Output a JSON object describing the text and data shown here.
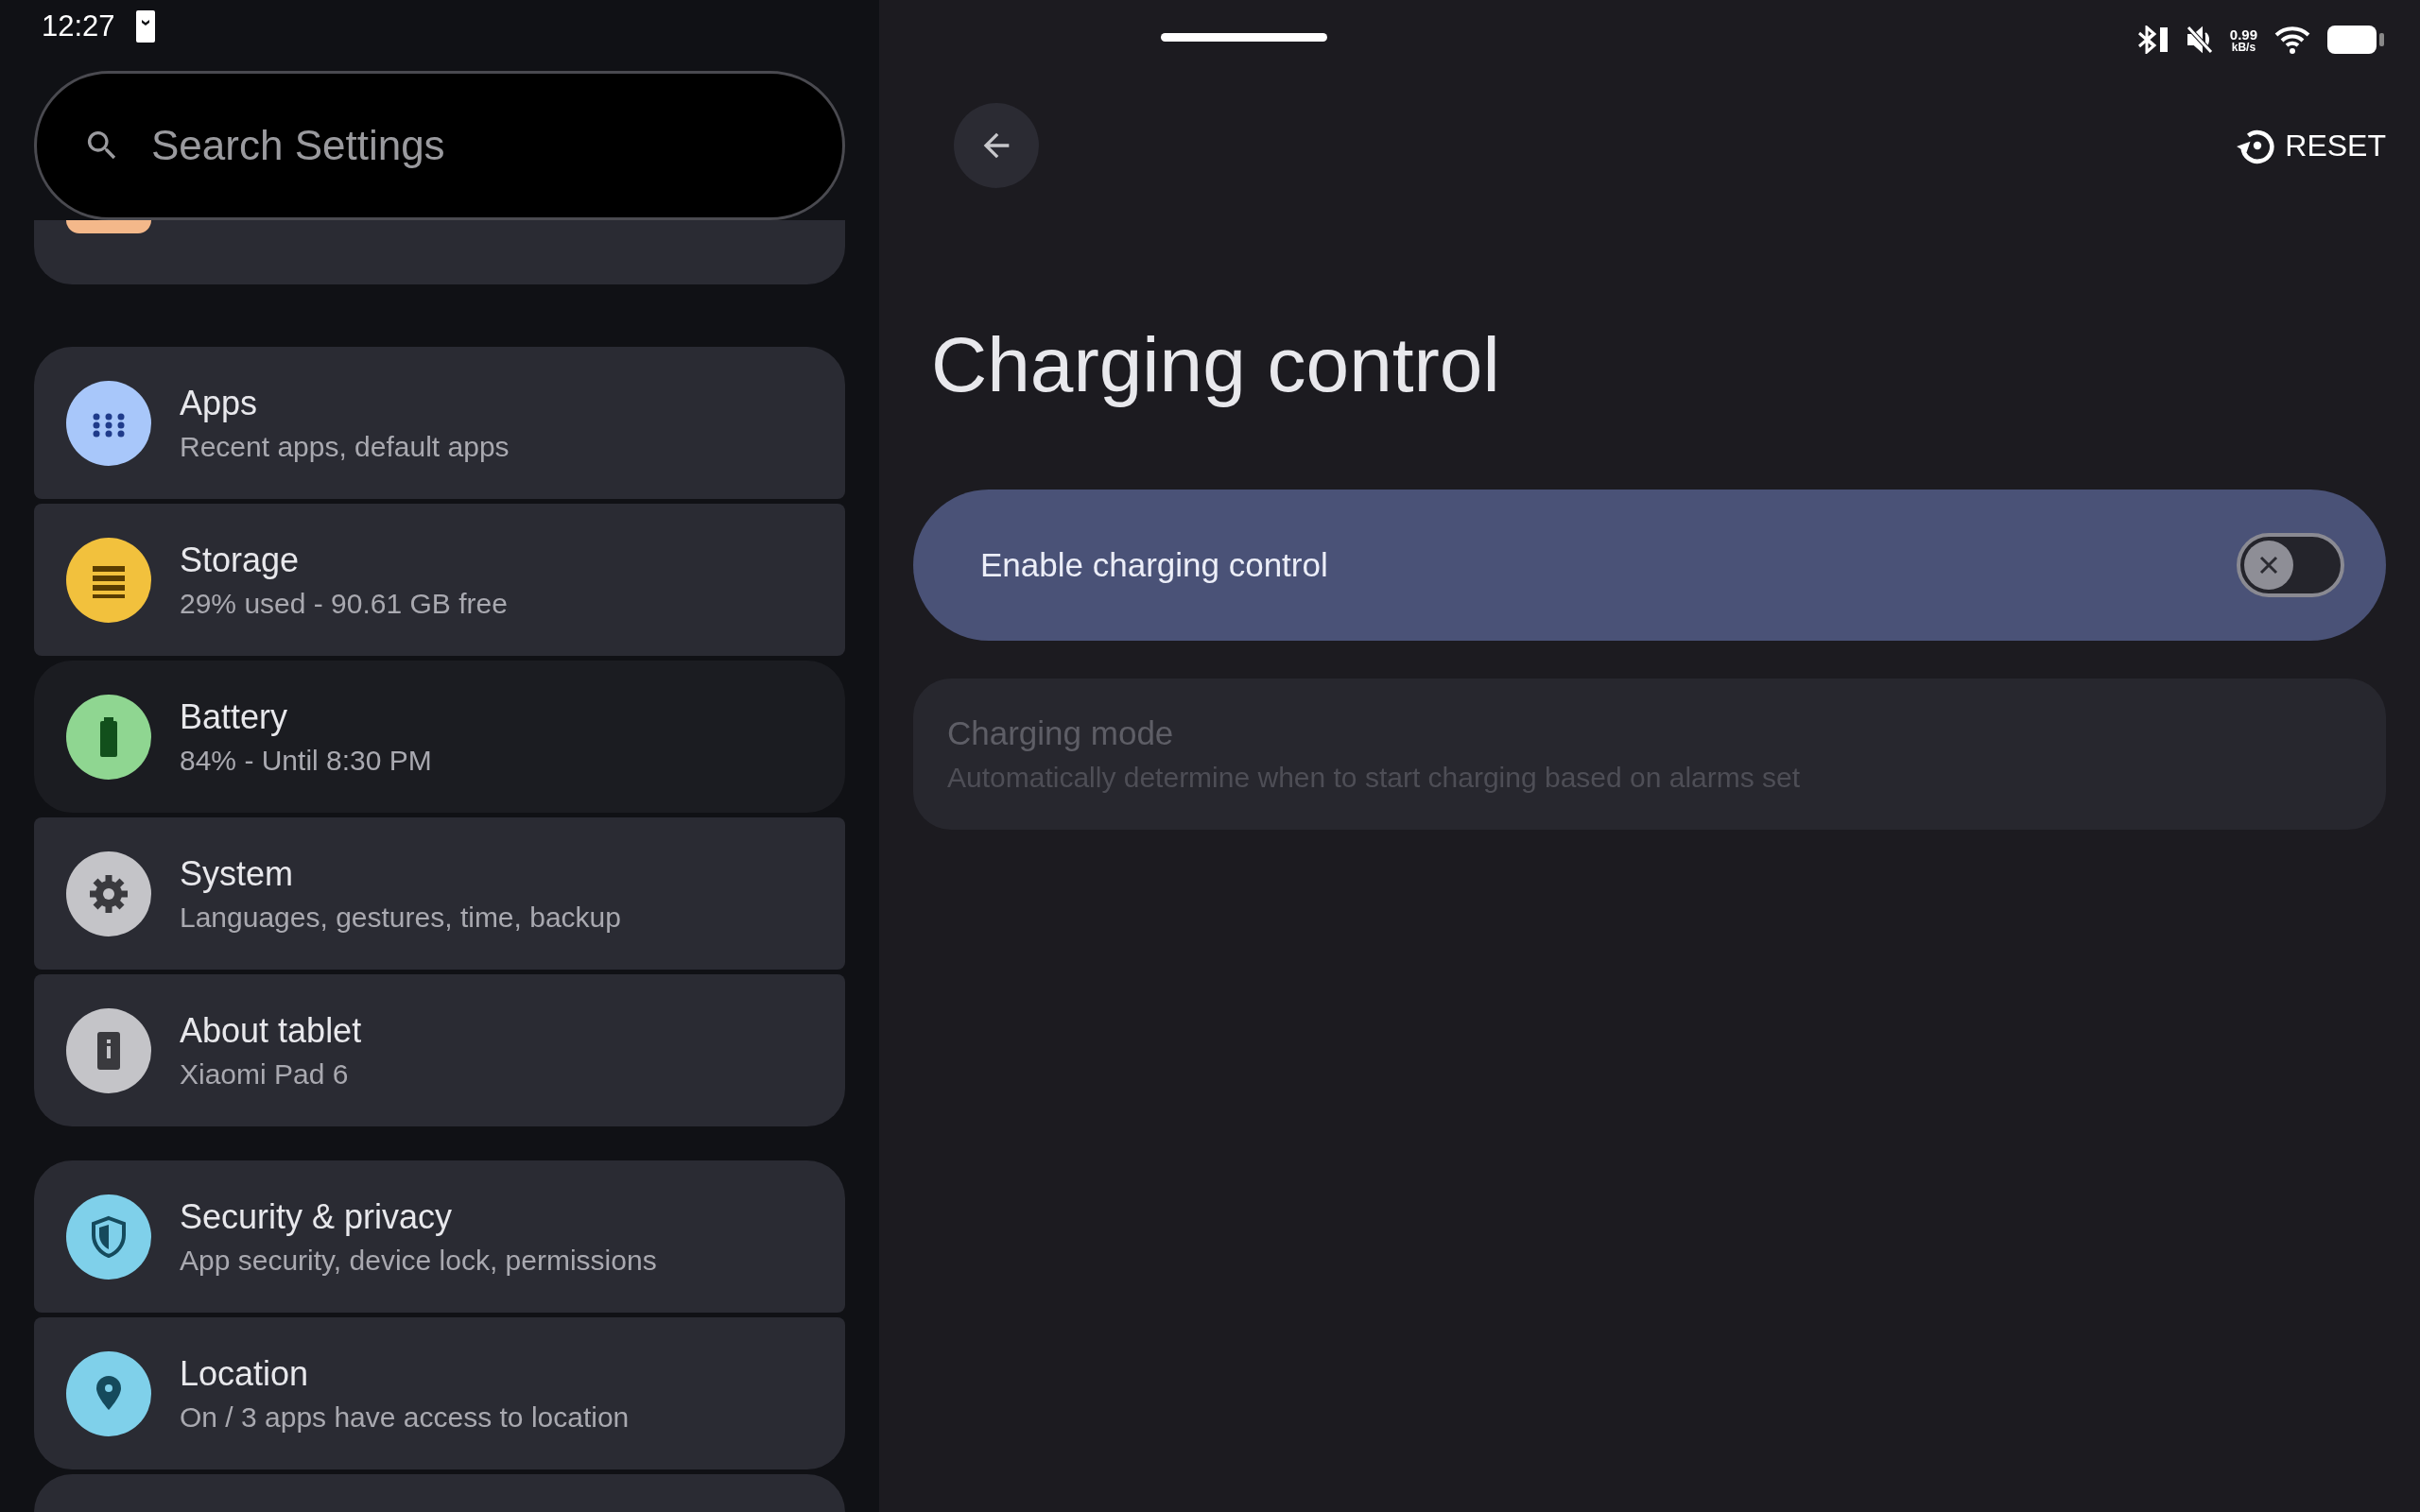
{
  "status_bar": {
    "time": "12:27",
    "speed_value": "0.99",
    "speed_unit": "kB/s"
  },
  "search": {
    "placeholder": "Search Settings"
  },
  "sidebar": {
    "groups": [
      {
        "items": [
          {
            "title": "Apps",
            "subtitle": "Recent apps, default apps",
            "kind": "apps",
            "color": "#a8c7fa",
            "selected": false
          },
          {
            "title": "Storage",
            "subtitle": "29% used - 90.61 GB free",
            "kind": "storage",
            "color": "#f2c13d",
            "selected": false
          },
          {
            "title": "Battery",
            "subtitle": "84% - Until 8:30 PM",
            "kind": "battery",
            "color": "#8fd691",
            "selected": true
          },
          {
            "title": "System",
            "subtitle": "Languages, gestures, time, backup",
            "kind": "system",
            "color": "#c4c4c8",
            "selected": false
          },
          {
            "title": "About tablet",
            "subtitle": "Xiaomi Pad 6",
            "kind": "about",
            "color": "#c4c4c8",
            "selected": false
          }
        ]
      },
      {
        "items": [
          {
            "title": "Security & privacy",
            "subtitle": "App security, device lock, permissions",
            "kind": "security",
            "color": "#7fd0ea",
            "selected": false
          },
          {
            "title": "Location",
            "subtitle": "On / 3 apps have access to location",
            "kind": "location",
            "color": "#7fd0ea",
            "selected": false
          }
        ]
      }
    ]
  },
  "page": {
    "reset_label": "RESET",
    "title": "Charging control",
    "settings": [
      {
        "kind": "switch",
        "label": "Enable charging control",
        "on": false
      },
      {
        "kind": "text",
        "title": "Charging mode",
        "subtitle": "Automatically determine when to start charging based on alarms set",
        "disabled": true
      }
    ]
  }
}
